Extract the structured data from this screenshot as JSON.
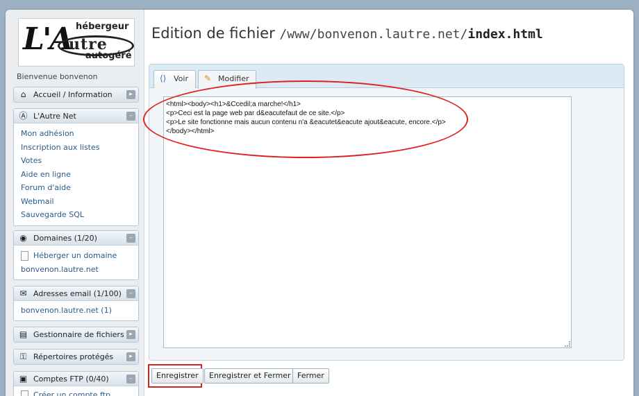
{
  "logo": {
    "big": "L'A",
    "ring": "utre",
    "top": "hébergeur",
    "bottom": "autogéré"
  },
  "welcome": "Bienvenue bonvenon",
  "sidebar": {
    "accueil": {
      "title": "Accueil / Information",
      "icon": "home-icon"
    },
    "lautre": {
      "title": "L'Autre Net",
      "icon": "anarchy-icon",
      "items": [
        "Mon adhésion",
        "Inscription aux listes",
        "Votes",
        "Aide en ligne",
        "Forum d'aide",
        "Webmail",
        "Sauvegarde SQL"
      ]
    },
    "domaines": {
      "title": "Domaines (1/20)",
      "icon": "globe-icon",
      "items": [
        "Héberger un domaine",
        "bonvenon.lautre.net"
      ]
    },
    "email": {
      "title": "Adresses email (1/100)",
      "icon": "email-icon",
      "items": [
        "bonvenon.lautre.net (1)"
      ]
    },
    "fichiers": {
      "title": "Gestionnaire de fichiers",
      "icon": "folder-icon"
    },
    "repertoires": {
      "title": "Répertoires protégés",
      "icon": "key-icon"
    },
    "ftp": {
      "title": "Comptes FTP (0/40)",
      "icon": "ftp-icon",
      "items": [
        "Créer un compte ftp"
      ]
    }
  },
  "main": {
    "title_label": "Edition de fichier",
    "path": "/www/bonvenon.lautre.net/",
    "filename": "index.html",
    "tabs": {
      "voir": "Voir",
      "modifier": "Modifier"
    },
    "editor_content": "<html><body><h1>&Ccedil;a marche!</h1>\n<p>Ceci est la page web par d&eacutefaut de ce site.</p>\n<p>Le site fonctionne mais aucun contenu n'a &eacutet&eacute ajout&eacute, encore.</p>\n</body></html>"
  },
  "buttons": {
    "save": "Enregistrer",
    "save_close": "Enregistrer et Fermer",
    "close": "Fermer"
  },
  "colors": {
    "highlight": "#e02020",
    "link": "#2a5b8c"
  }
}
